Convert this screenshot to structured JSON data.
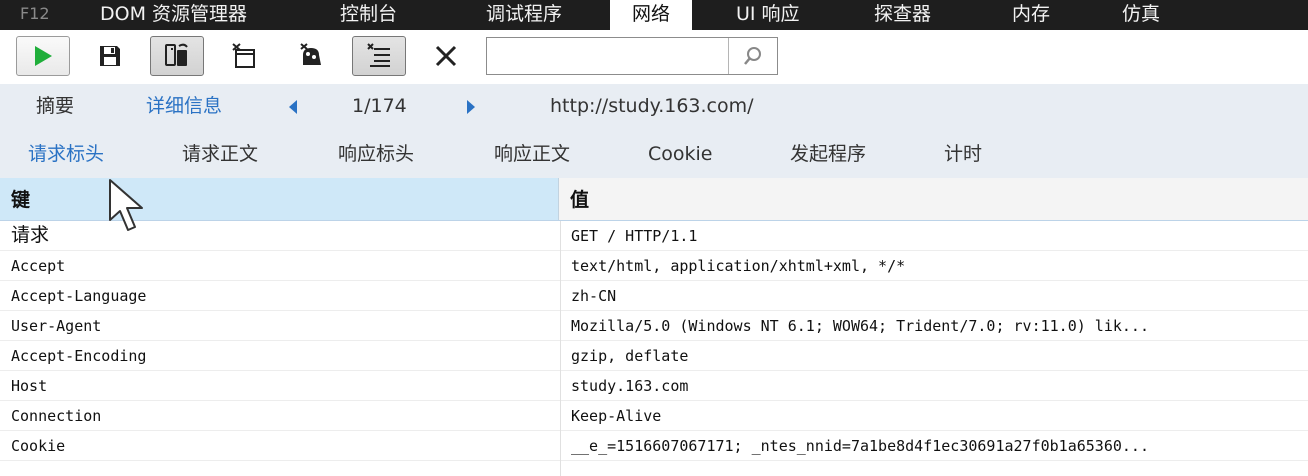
{
  "topbar": {
    "tabs": [
      {
        "label": "F12"
      },
      {
        "label": "DOM 资源管理器"
      },
      {
        "label": "控制台"
      },
      {
        "label": "调试程序"
      },
      {
        "label": "网络"
      },
      {
        "label": "UI 响应"
      },
      {
        "label": "探查器"
      },
      {
        "label": "内存"
      },
      {
        "label": "仿真"
      }
    ],
    "active": "网络"
  },
  "toolbar": {
    "buttons": [
      {
        "name": "start-capture-button",
        "icon": "play-icon"
      },
      {
        "name": "export-har-button",
        "icon": "save-icon"
      },
      {
        "name": "always-refresh-button",
        "icon": "server-refresh-icon"
      },
      {
        "name": "clear-entries-on-navigate-button",
        "icon": "clear-navigate-icon"
      },
      {
        "name": "clear-cache-button",
        "icon": "clear-cache-icon"
      },
      {
        "name": "content-type-filter-button",
        "icon": "filter-list-icon"
      },
      {
        "name": "clear-session-button",
        "icon": "close-icon"
      }
    ],
    "search": {
      "value": "",
      "placeholder": ""
    },
    "accent_green": "#1fae3a"
  },
  "nav": {
    "summary_label": "摘要",
    "detail_label": "详细信息",
    "page_counter": "1/174",
    "url": "http://study.163.com/"
  },
  "subtabs": {
    "items": [
      {
        "label": "请求标头"
      },
      {
        "label": "请求正文"
      },
      {
        "label": "响应标头"
      },
      {
        "label": "响应正文"
      },
      {
        "label": "Cookie"
      },
      {
        "label": "发起程序"
      },
      {
        "label": "计时"
      }
    ],
    "active": "请求标头"
  },
  "table": {
    "headers": {
      "key": "键",
      "value": "值"
    },
    "rows": [
      {
        "key": "请求",
        "value": "GET / HTTP/1.1"
      },
      {
        "key": "Accept",
        "value": "text/html, application/xhtml+xml, */*"
      },
      {
        "key": "Accept-Language",
        "value": "zh-CN"
      },
      {
        "key": "User-Agent",
        "value": "Mozilla/5.0 (Windows NT 6.1; WOW64; Trident/7.0; rv:11.0) lik..."
      },
      {
        "key": "Accept-Encoding",
        "value": "gzip, deflate"
      },
      {
        "key": "Host",
        "value": "study.163.com"
      },
      {
        "key": "Connection",
        "value": "Keep-Alive"
      },
      {
        "key": "Cookie",
        "value": "__e_=1516607067171; _ntes_nnid=7a1be8d4f1ec30691a27f0b1a65360..."
      }
    ]
  },
  "colors": {
    "topbar_bg": "#1e1e1e",
    "link_blue": "#2a72c4",
    "header_key_bg": "#cfe8f8",
    "nav_bg": "#e8edf3"
  }
}
